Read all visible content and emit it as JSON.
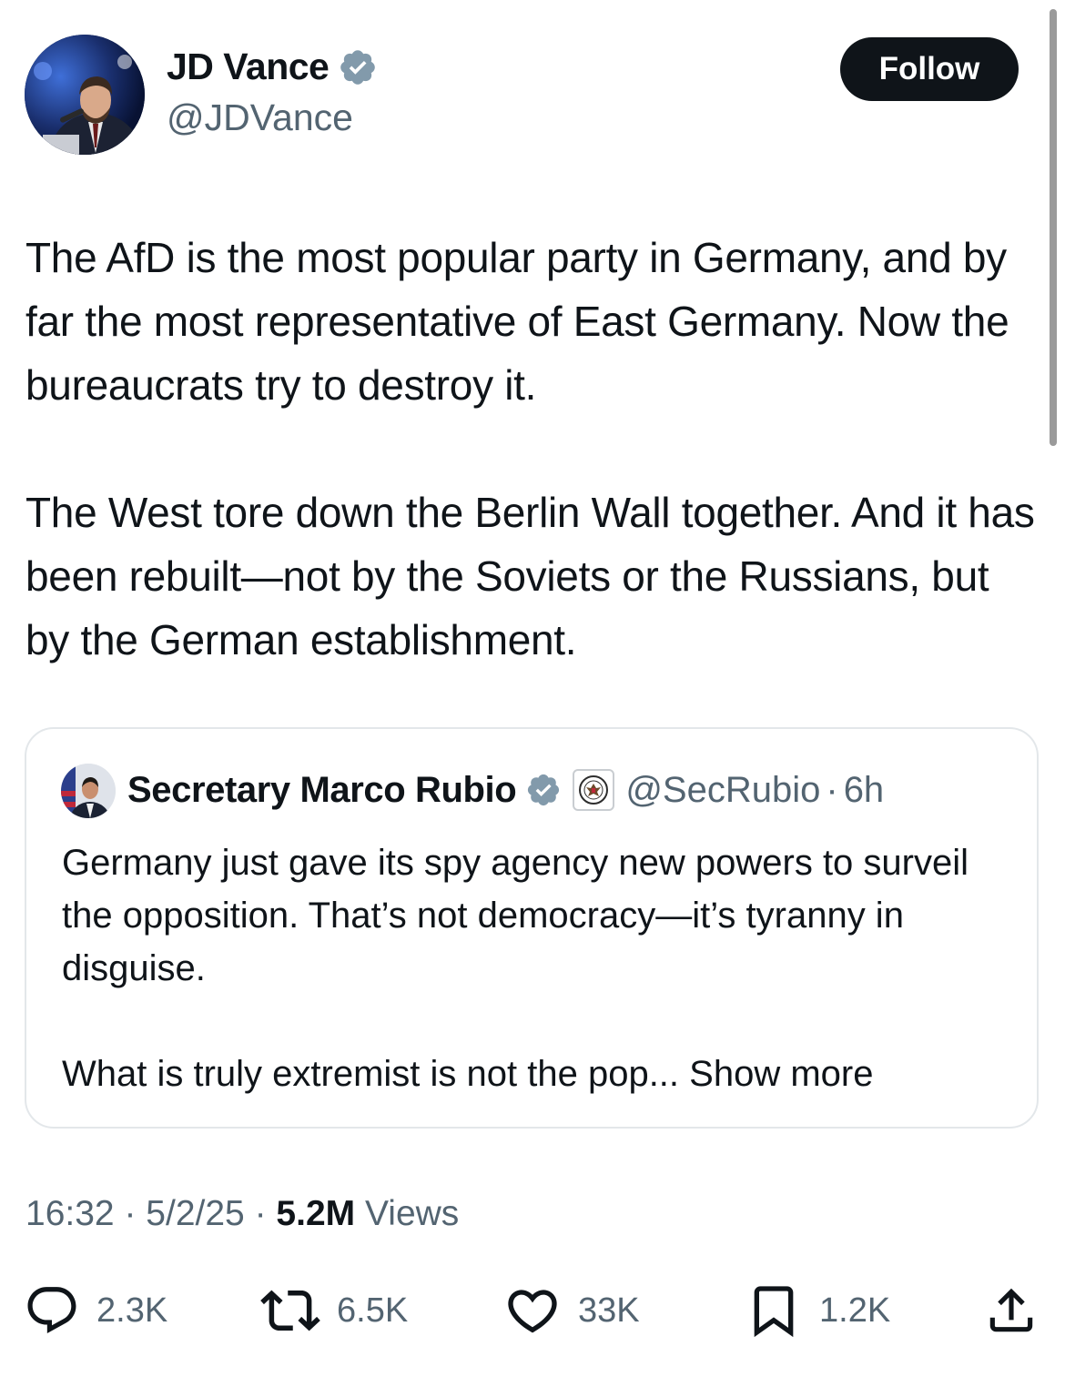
{
  "author": {
    "name": "JD Vance",
    "handle": "@JDVance"
  },
  "follow_label": "Follow",
  "tweet": {
    "paragraphs": [
      "The AfD is the most popular party in Germany, and by far the most representative of East Germany. Now the bureaucrats try to destroy it.",
      "The West tore down the Berlin Wall together. And it has been rebuilt—not by the Soviets or the Russians, but by the German establishment."
    ]
  },
  "quote": {
    "name": "Secretary Marco Rubio",
    "handle": "@SecRubio",
    "separator": "·",
    "time": "6h",
    "paragraphs": [
      "Germany just gave its spy agency new powers to surveil the opposition.  That’s not democracy—it’s tyranny in disguise.",
      "What is truly extremist is not the pop..."
    ],
    "show_more": "Show more"
  },
  "meta": {
    "time": "16:32",
    "dot": "·",
    "date": "5/2/25",
    "views_count": "5.2M",
    "views_label": "Views"
  },
  "actions": {
    "replies": "2.3K",
    "reposts": "6.5K",
    "likes": "33K",
    "bookmarks": "1.2K"
  },
  "colors": {
    "text": "#0f1419",
    "secondary": "#536471",
    "verified": "#829aab",
    "follow_bg": "#0f1419",
    "border": "#e3e7ea"
  },
  "icons": [
    "verified-badge-icon",
    "government-seal-icon",
    "reply-icon",
    "repost-icon",
    "like-icon",
    "bookmark-icon",
    "share-icon"
  ]
}
